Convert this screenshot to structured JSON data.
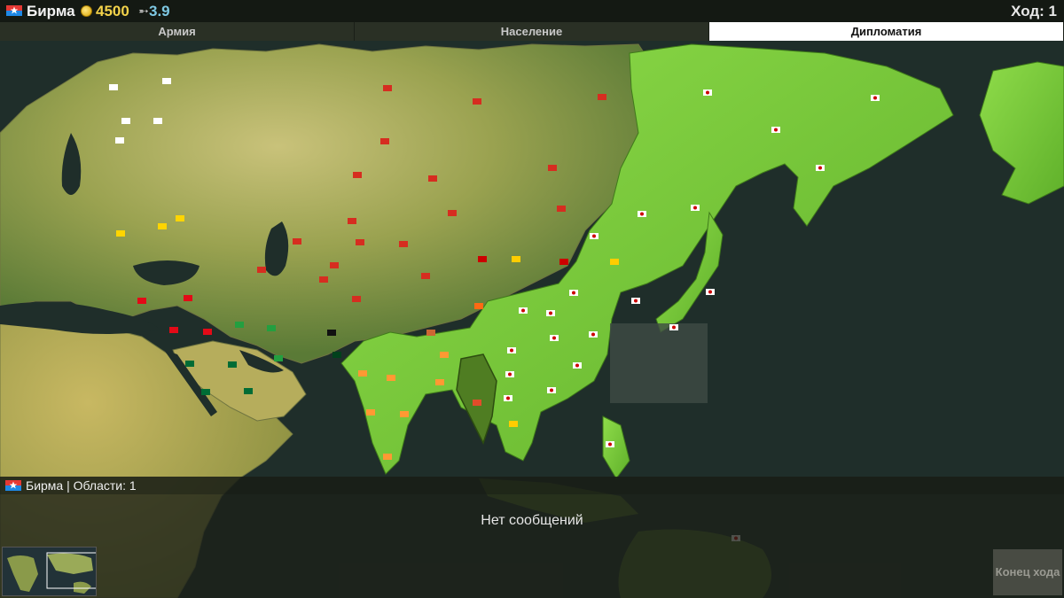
{
  "header": {
    "country_name": "Бирма",
    "gold": "4500",
    "score": "3.9",
    "turn": "Ход: 1"
  },
  "tabs": [
    {
      "label": "Армия",
      "active": false
    },
    {
      "label": "Население",
      "active": false
    },
    {
      "label": "Дипломатия",
      "active": true
    }
  ],
  "info_bar": {
    "text": "Бирма | Области: 1"
  },
  "messages": {
    "empty_text": "Нет сообщений"
  },
  "end_turn_button": {
    "label": "Конец хода",
    "enabled": false
  },
  "colors": {
    "ocean": "#1f2e2a",
    "neutral_land": "#b4b05a",
    "allied_green": "#78c93a",
    "selected_country": "#4f7d22",
    "gold_text": "#f3d24a",
    "score_text": "#7ec8e3"
  },
  "icons": [
    "country-flag-icon",
    "coin-icon",
    "arrow-icon",
    "minimap-icon"
  ]
}
